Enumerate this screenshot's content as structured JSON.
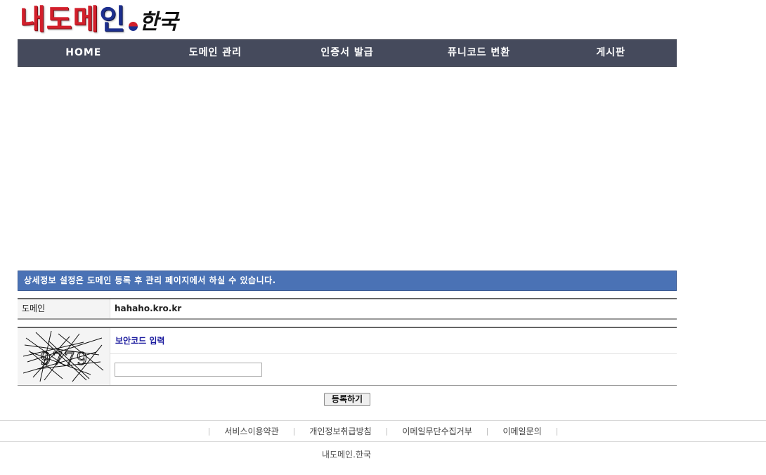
{
  "logo": {
    "part1": "내도메",
    "part2": "인",
    "part3": "한국"
  },
  "nav": {
    "items": [
      {
        "label": "HOME"
      },
      {
        "label": "도메인 관리"
      },
      {
        "label": "인증서 발급"
      },
      {
        "label": "퓨니코드 변환"
      },
      {
        "label": "게시판"
      }
    ]
  },
  "notice": {
    "text": "상세정보 설정은 도메인 등록 후 관리 페이지에서 하실 수 있습니다."
  },
  "domain": {
    "label": "도메인",
    "value": "hahaho.kro.kr"
  },
  "captcha": {
    "code": "9779",
    "title": "보안코드 입력",
    "input_value": ""
  },
  "submit": {
    "label": "등록하기"
  },
  "footer": {
    "links": [
      {
        "label": "서비스이용약관"
      },
      {
        "label": "개인정보취급방침"
      },
      {
        "label": "이메일무단수집거부"
      },
      {
        "label": "이메일문의"
      }
    ],
    "copyright": "내도메인.한국"
  },
  "colors": {
    "nav_bg": "#454a5c",
    "notice_bg": "#4a72b5",
    "captcha_title": "#1a1a9e",
    "logo_red": "#d21f2b",
    "logo_blue": "#1d2f8e"
  }
}
